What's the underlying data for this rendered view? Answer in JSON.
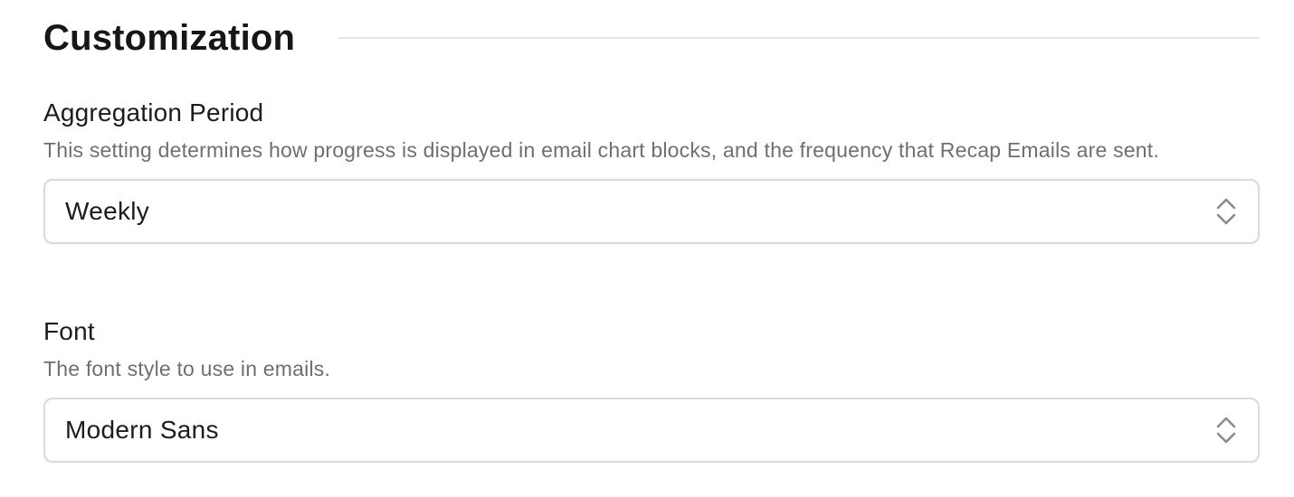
{
  "section": {
    "title": "Customization"
  },
  "aggregation": {
    "label": "Aggregation Period",
    "help": "This setting determines how progress is displayed in email chart blocks, and the frequency that Recap Emails are sent.",
    "value": "Weekly",
    "icon": "chevron-up-down-icon"
  },
  "font": {
    "label": "Font",
    "help": "The font style to use in emails.",
    "value": "Modern Sans",
    "icon": "chevron-up-down-icon"
  },
  "colors": {
    "text": "#1c1c1c",
    "muted": "#6f6f73",
    "border": "#d9d9de",
    "divider": "#e6e6e6"
  }
}
